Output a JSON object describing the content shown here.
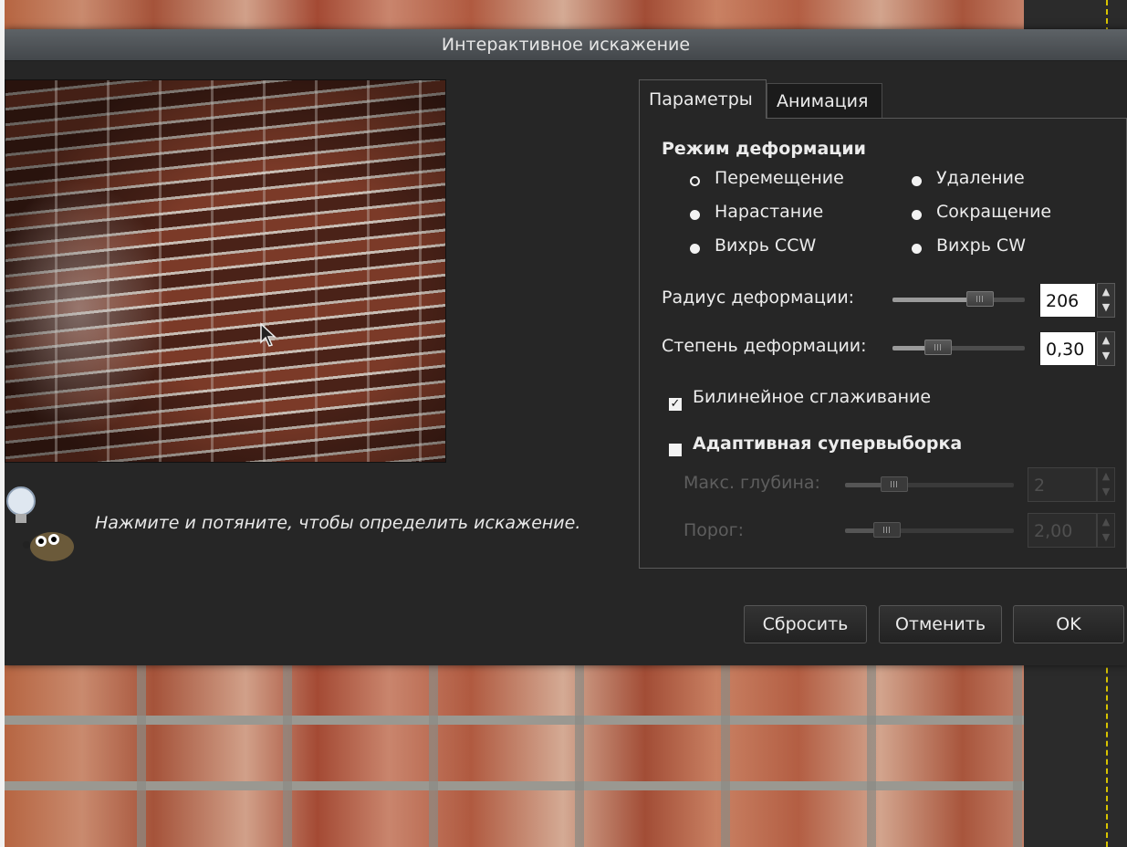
{
  "dialog": {
    "title": "Интерактивное искажение",
    "hint": "Нажмите и потяните, чтобы определить искажение."
  },
  "tabs": [
    {
      "label": "Параметры",
      "active": true
    },
    {
      "label": "Анимация",
      "active": false
    }
  ],
  "deform_mode": {
    "heading": "Режим деформации",
    "options": [
      {
        "label": "Перемещение",
        "selected": true
      },
      {
        "label": "Удаление",
        "selected": false
      },
      {
        "label": "Нарастание",
        "selected": false
      },
      {
        "label": "Сокращение",
        "selected": false
      },
      {
        "label": "Вихрь CCW",
        "selected": false
      },
      {
        "label": "Вихрь CW",
        "selected": false
      }
    ]
  },
  "radius": {
    "label": "Радиус деформации:",
    "value": "206",
    "fraction": 0.7
  },
  "amount": {
    "label": "Степень деформации:",
    "value": "0,30",
    "fraction": 0.3
  },
  "bilinear": {
    "label": "Билинейное сглаживание",
    "checked": true
  },
  "adaptive": {
    "label": "Адаптивная супервыборка",
    "checked": false
  },
  "max_depth": {
    "label": "Макс. глубина:",
    "value": "2",
    "fraction": 0.25
  },
  "threshold": {
    "label": "Порог:",
    "value": "2,00",
    "fraction": 0.2
  },
  "buttons": {
    "reset": "Сбросить",
    "cancel": "Отменить",
    "ok": "OK"
  }
}
